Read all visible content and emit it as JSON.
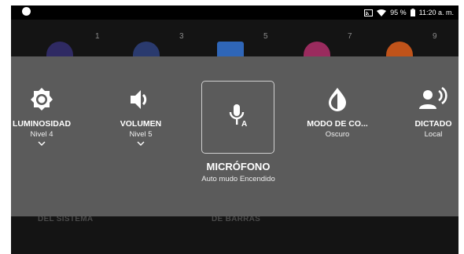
{
  "statusbar": {
    "battery": "95 %",
    "time": "11:20 a. m."
  },
  "background": {
    "page_numbers": [
      "1",
      "3",
      "5",
      "7",
      "9"
    ],
    "bottom_labels": [
      "DEL SISTEMA",
      "DE BARRAS"
    ]
  },
  "tiles": [
    {
      "title": "LUMINOSIDAD",
      "subtitle": "Nivel 4",
      "icon": "brightness-icon"
    },
    {
      "title": "VOLUMEN",
      "subtitle": "Nivel 5",
      "icon": "volume-icon"
    },
    {
      "title": "MODO DE CO...",
      "subtitle": "Oscuro",
      "icon": "contrast-icon"
    },
    {
      "title": "DICTADO",
      "subtitle": "Local",
      "icon": "dictation-icon"
    }
  ],
  "selected_tile": {
    "title": "MICRÓFONO",
    "subtitle": "Auto mudo Encendido",
    "icon": "microphone-icon"
  },
  "colors": {
    "panel": "#5b5b5b",
    "screen_bg": "#141414",
    "statusbar": "#000000"
  }
}
